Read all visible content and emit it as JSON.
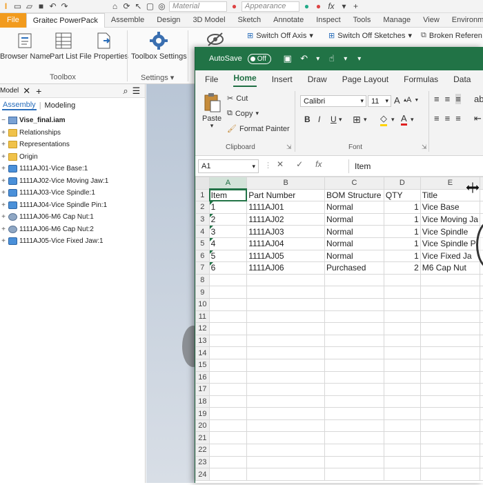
{
  "inventor": {
    "qat": {
      "material_placeholder": "Material",
      "appearance_placeholder": "Appearance",
      "fx": "fx"
    },
    "tabs": [
      "File",
      "Graitec PowerPack",
      "Assemble",
      "Design",
      "3D Model",
      "Sketch",
      "Annotate",
      "Inspect",
      "Tools",
      "Manage",
      "View",
      "Environments"
    ],
    "ribbon": {
      "browser_name": "Browser Name",
      "part_list": "Part List",
      "file_properties": "File Properties",
      "toolbox_settings": "Toolbox Settings",
      "group_toolbox": "Toolbox",
      "group_settings": "Settings",
      "switch_off_axis": "Switch Off Axis",
      "switch_off_sketches": "Switch Off Sketches",
      "broken_references": "Broken Referen"
    },
    "browser": {
      "title": "Model",
      "tabs": [
        "Assembly",
        "Modeling"
      ],
      "root": "Vise_final.iam",
      "items": [
        {
          "label": "Relationships",
          "icon": "folder"
        },
        {
          "label": "Representations",
          "icon": "folder"
        },
        {
          "label": "Origin",
          "icon": "folder"
        },
        {
          "label": "1111AJ01-Vice Base:1",
          "icon": "part"
        },
        {
          "label": "1111AJ02-Vice Moving Jaw:1",
          "icon": "part"
        },
        {
          "label": "1111AJ03-Vice Spindle:1",
          "icon": "part"
        },
        {
          "label": "1111AJ04-Vice Spindle Pin:1",
          "icon": "part"
        },
        {
          "label": "1111AJ06-M6 Cap Nut:1",
          "icon": "bolt"
        },
        {
          "label": "1111AJ06-M6 Cap Nut:2",
          "icon": "bolt"
        },
        {
          "label": "1111AJ05-Vice Fixed Jaw:1",
          "icon": "part"
        }
      ]
    }
  },
  "excel": {
    "autosave": "AutoSave",
    "autosave_state": "Off",
    "tabs": [
      "File",
      "Home",
      "Insert",
      "Draw",
      "Page Layout",
      "Formulas",
      "Data"
    ],
    "active_tab": "Home",
    "clipboard": {
      "paste": "Paste",
      "cut": "Cut",
      "copy": "Copy",
      "format_painter": "Format Painter",
      "group": "Clipboard"
    },
    "font": {
      "name": "Calibri",
      "size": "11",
      "bold": "B",
      "italic": "I",
      "underline": "U",
      "group": "Font"
    },
    "name_box": "A1",
    "fx": "fx",
    "formula": "Item",
    "columns": [
      "A",
      "B",
      "C",
      "D",
      "E"
    ],
    "rows": [
      [
        "Item",
        "Part Number",
        "BOM Structure",
        "QTY",
        "Title"
      ],
      [
        "1",
        "1111AJ01",
        "Normal",
        "1",
        "Vice Base"
      ],
      [
        "2",
        "1111AJ02",
        "Normal",
        "1",
        "Vice Moving Ja"
      ],
      [
        "3",
        "1111AJ03",
        "Normal",
        "1",
        "Vice Spindle"
      ],
      [
        "4",
        "1111AJ04",
        "Normal",
        "1",
        "Vice Spindle P"
      ],
      [
        "5",
        "1111AJ05",
        "Normal",
        "1",
        "Vice Fixed Ja"
      ],
      [
        "6",
        "1111AJ06",
        "Purchased",
        "2",
        "M6 Cap Nut"
      ]
    ],
    "total_row_labels": 24
  },
  "colors": {
    "excel_green": "#217346",
    "inventor_file": "#f29b1d"
  }
}
